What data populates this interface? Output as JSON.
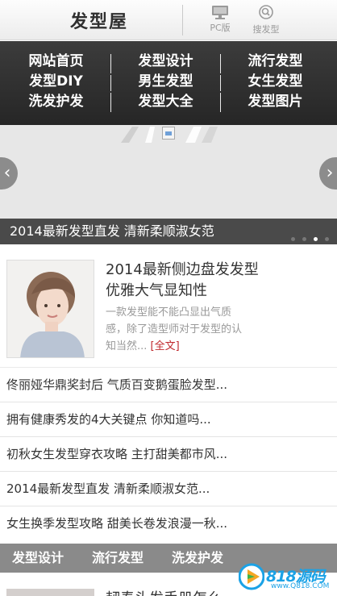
{
  "header": {
    "logo": "发型屋",
    "pc_label": "PC版",
    "search_label": "搜发型"
  },
  "nav": {
    "rows": [
      [
        "网站首页",
        "发型设计",
        "流行发型"
      ],
      [
        "发型DIY",
        "男生发型",
        "女生发型"
      ],
      [
        "洗发护发",
        "发型大全",
        "发型图片"
      ]
    ]
  },
  "banner": {
    "caption": "2014最新发型直发 清新柔顺淑女范",
    "slide_count": 4,
    "active_slide": 3,
    "prev_label": "‹",
    "next_label": "›"
  },
  "featured": {
    "title": "2014最新侧边盘发发型 优雅大气显知性",
    "summary": "一款发型能不能凸显出气质感，除了造型师对于发型的认知当然...",
    "more": "[全文]"
  },
  "list": [
    "佟丽娅华鼎奖封后 气质百变鹅蛋脸发型...",
    "拥有健康秀发的4大关键点 你知道吗...",
    "初秋女生发型穿衣攻略 主打甜美都市风...",
    "2014最新发型直发 清新柔顺淑女范...",
    "女生换季发型攻略 甜美长卷发浪漫一秋..."
  ],
  "category_bar": [
    "发型设计",
    "流行发型",
    "洗发护发"
  ],
  "peek_title": "韧奏头发手册怎么",
  "watermark": {
    "text": "818源码",
    "sub": "www.Q818.COM"
  },
  "colors": {
    "nav_bg": "#2e2e2e",
    "caption_bg": "#4a4a4a",
    "more_link": "#c0282d",
    "category_bg": "#8a8a8a",
    "watermark": "#1ba2e6"
  }
}
